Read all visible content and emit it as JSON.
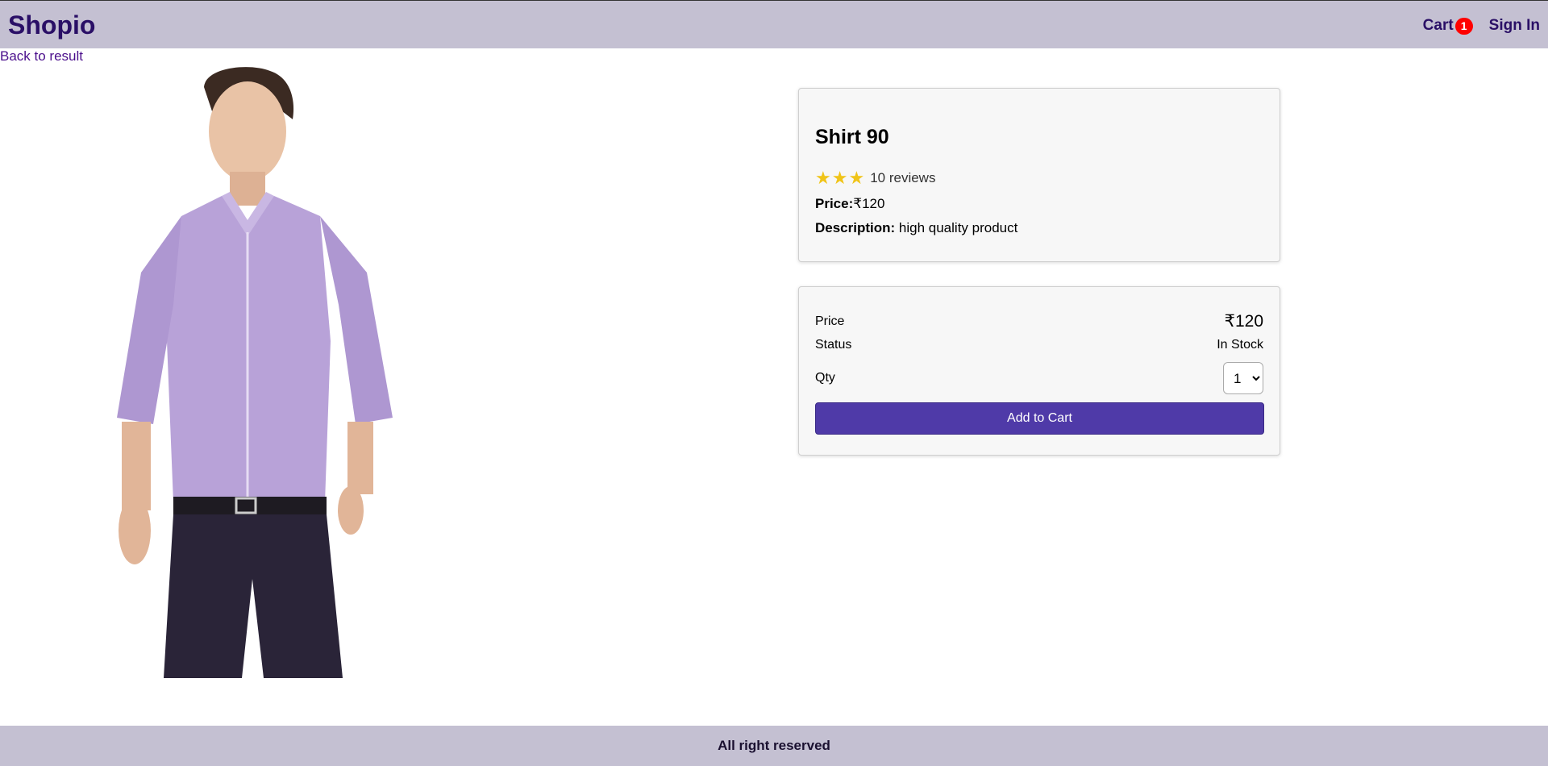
{
  "header": {
    "brand": "Shopio",
    "cart_label": "Cart",
    "cart_count": "1",
    "signin_label": "Sign In"
  },
  "nav": {
    "back_label": "Back to result"
  },
  "product": {
    "image_icon": "shirt-model-photo",
    "name": "Shirt 90",
    "rating": 3,
    "rating_max": 3,
    "stars": [
      "★",
      "★",
      "★"
    ],
    "reviews": "10 reviews",
    "price_label": "Price:",
    "price_value": "₹120",
    "description_label": "Description:",
    "description_value": " high quality product"
  },
  "buy_box": {
    "price_label": "Price",
    "price_value": "₹120",
    "status_label": "Status",
    "status_value": "In Stock",
    "qty_label": "Qty",
    "qty_selected": "1",
    "add_button_label": "Add to Cart"
  },
  "footer": {
    "text": "All right reserved"
  },
  "colors": {
    "header_bg": "#c4c0d2",
    "brand": "#2a0f66",
    "badge": "#ff0000",
    "button": "#4f3aa8",
    "star": "#f0c419",
    "shirt": "#b8a2d8",
    "pants": "#2a2438"
  }
}
